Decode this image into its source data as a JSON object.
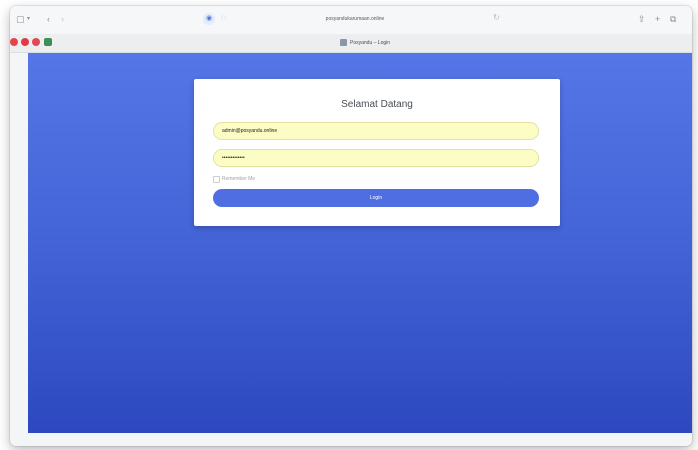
{
  "browser": {
    "url": "posyandukarumaan.online",
    "tab_title": "Posyandu – Login"
  },
  "login": {
    "heading": "Selamat Datang",
    "email_value": "admin@posyandu.online",
    "password_value": "•••••••••••••",
    "remember_label": "Remember Me",
    "remember_checked": false,
    "login_label": "Login"
  },
  "colors": {
    "background_top": "#5576e6",
    "background_bottom": "#2d48c0",
    "input_fill": "#fcfdc4",
    "button": "#4f6ee2"
  },
  "icons": {
    "toolbar_left": [
      "sidebar-icon",
      "chevron-down-icon",
      "back-icon",
      "forward-icon"
    ],
    "address": [
      "shield-icon",
      "reload-icon"
    ],
    "toolbar_right": [
      "share-icon",
      "new-tab-icon",
      "tabs-overview-icon"
    ]
  }
}
